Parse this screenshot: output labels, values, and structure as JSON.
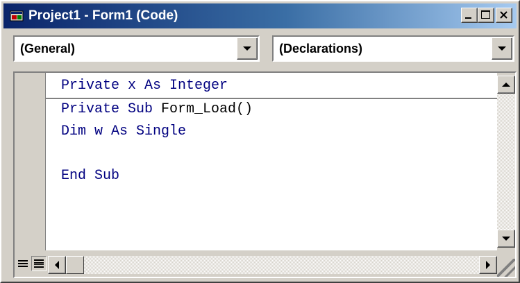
{
  "window": {
    "title": "Project1 - Form1 (Code)",
    "icon": "vb-project-icon"
  },
  "title_buttons": [
    "minimize-icon",
    "maximize-icon",
    "close-icon"
  ],
  "toolbar": {
    "object_combo_value": "(General)",
    "procedure_combo_value": "(Declarations)"
  },
  "code": {
    "lines": [
      {
        "keyword": "Private x As Integer",
        "plain": ""
      },
      {
        "keyword": "Private Sub ",
        "plain": "Form_Load()"
      },
      {
        "keyword": "Dim w As Single",
        "plain": ""
      },
      {
        "keyword": "",
        "plain": ""
      },
      {
        "keyword": "End Sub",
        "plain": ""
      }
    ]
  },
  "colors": {
    "keyword": "#000080",
    "plain": "#000000",
    "title_gradient_start": "#0a246a",
    "title_gradient_end": "#a6caf0",
    "chrome": "#d4d0c8"
  },
  "bottom_bar": {
    "view_buttons": [
      "procedure-view-icon",
      "full-module-view-icon"
    ]
  }
}
